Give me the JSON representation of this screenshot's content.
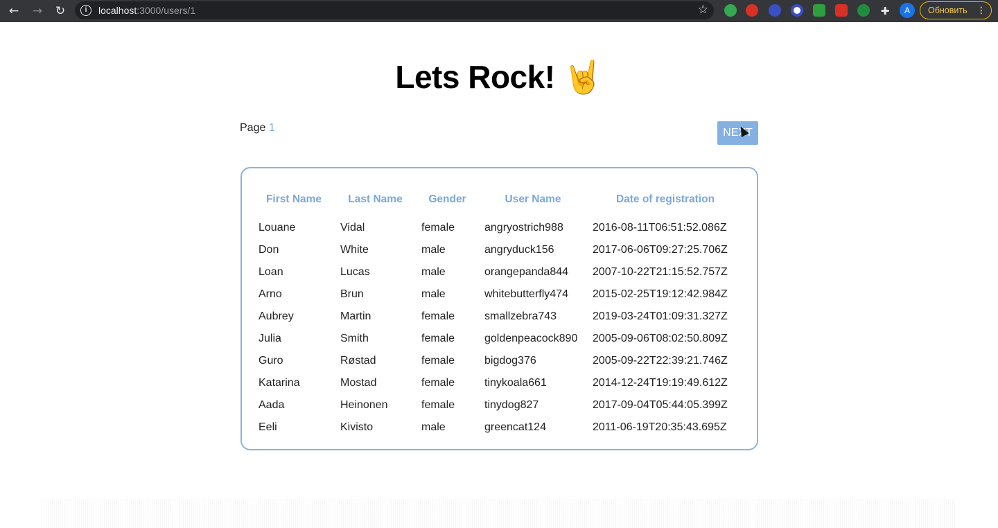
{
  "browser": {
    "url_host": "localhost",
    "url_path": ":3000/users/1",
    "update_label": "Обновить",
    "profile_initial": "A",
    "icons": [
      "back-icon",
      "forward-icon",
      "reload-icon",
      "info-icon",
      "star-icon",
      "extension-icon"
    ]
  },
  "page": {
    "title": "Lets Rock!",
    "title_emoji": "🤘",
    "page_label": "Page",
    "page_number": "1",
    "next_label": "NEXT"
  },
  "table": {
    "headers": [
      "First Name",
      "Last Name",
      "Gender",
      "User Name",
      "Date of registration"
    ],
    "rows": [
      [
        "Louane",
        "Vidal",
        "female",
        "angryostrich988",
        "2016-08-11T06:51:52.086Z"
      ],
      [
        "Don",
        "White",
        "male",
        "angryduck156",
        "2017-06-06T09:27:25.706Z"
      ],
      [
        "Loan",
        "Lucas",
        "male",
        "orangepanda844",
        "2007-10-22T21:15:52.757Z"
      ],
      [
        "Arno",
        "Brun",
        "male",
        "whitebutterfly474",
        "2015-02-25T19:12:42.984Z"
      ],
      [
        "Aubrey",
        "Martin",
        "female",
        "smallzebra743",
        "2019-03-24T01:09:31.327Z"
      ],
      [
        "Julia",
        "Smith",
        "female",
        "goldenpeacock890",
        "2005-09-06T08:02:50.809Z"
      ],
      [
        "Guro",
        "Røstad",
        "female",
        "bigdog376",
        "2005-09-22T22:39:21.746Z"
      ],
      [
        "Katarina",
        "Mostad",
        "female",
        "tinykoala661",
        "2014-12-24T19:19:49.612Z"
      ],
      [
        "Aada",
        "Heinonen",
        "female",
        "tinydog827",
        "2017-09-04T05:44:05.399Z"
      ],
      [
        "Eeli",
        "Kivisto",
        "male",
        "greencat124",
        "2011-06-19T20:35:43.695Z"
      ]
    ]
  },
  "colors": {
    "accent": "#7aa8da",
    "button": "#85b0e2",
    "border": "#8ab4e0"
  }
}
